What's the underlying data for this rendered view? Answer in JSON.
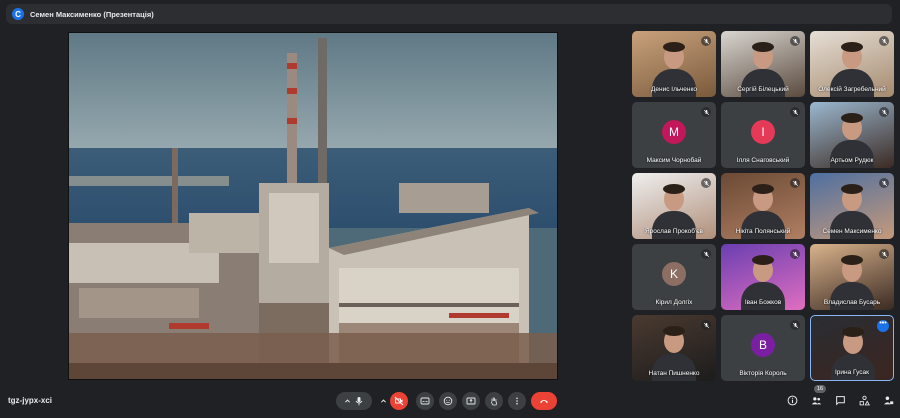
{
  "header": {
    "presenter_initial": "C",
    "title": "Семен Максименко (Презентація)"
  },
  "stage": {
    "content": "presentation-slide-power-plant-photo"
  },
  "participants": [
    {
      "name": "Денис Ільченко",
      "muted": true,
      "type": "video"
    },
    {
      "name": "Сергій Білецький",
      "muted": true,
      "type": "video"
    },
    {
      "name": "Олексій Загребельний",
      "muted": true,
      "type": "video"
    },
    {
      "name": "Максим Чорнобай",
      "muted": true,
      "type": "initial",
      "initial": "М",
      "color": "#c2185b"
    },
    {
      "name": "Ілля Снаговський",
      "muted": true,
      "type": "initial",
      "initial": "І",
      "color": "#e53958"
    },
    {
      "name": "Артьом Рудюк",
      "muted": true,
      "type": "video"
    },
    {
      "name": "Ярослав Прокоб'єв",
      "muted": true,
      "type": "video"
    },
    {
      "name": "Нікіта Полянський",
      "muted": true,
      "type": "video"
    },
    {
      "name": "Семен Максименко",
      "muted": true,
      "type": "video"
    },
    {
      "name": "Кірил Долгіх",
      "muted": true,
      "type": "initial",
      "initial": "K",
      "color": "#8d6e63"
    },
    {
      "name": "Іван Божков",
      "muted": true,
      "type": "video"
    },
    {
      "name": "Владислав Бусарь",
      "muted": true,
      "type": "video"
    },
    {
      "name": "Натан Пишненко",
      "muted": true,
      "type": "video"
    },
    {
      "name": "Вікторія Король",
      "muted": true,
      "type": "initial",
      "initial": "В",
      "color": "#7b1fa2"
    },
    {
      "name": "Ірина Гусак",
      "muted": false,
      "type": "video"
    }
  ],
  "footer": {
    "meeting_code": "tgz-jypx-xci",
    "participant_count": "16"
  },
  "colors": {
    "accent": "#1a73e8",
    "danger": "#ea4335",
    "surface": "#3c4043",
    "background": "#202124"
  }
}
